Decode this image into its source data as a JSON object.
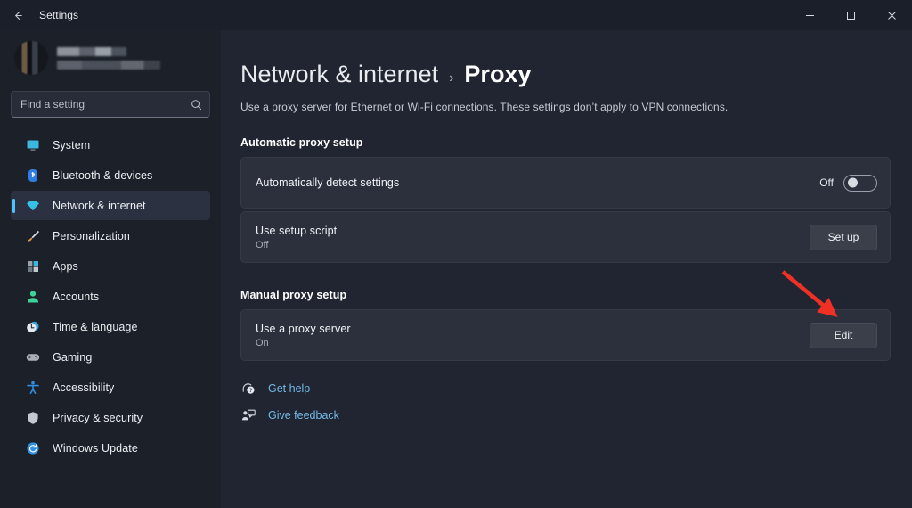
{
  "window": {
    "titlebar_title": "Settings",
    "back_icon": "arrow-left-icon",
    "minimize_label": "Minimize",
    "maximize_label": "Maximize",
    "close_label": "Close"
  },
  "sidebar": {
    "profile": {
      "redacted": true,
      "avatar_icon": "user-avatar"
    },
    "search": {
      "placeholder": "Find a setting",
      "value": "",
      "icon": "search-icon"
    },
    "items": [
      {
        "label": "System",
        "icon": "monitor-icon",
        "active": false
      },
      {
        "label": "Bluetooth & devices",
        "icon": "bluetooth-icon",
        "active": false
      },
      {
        "label": "Network & internet",
        "icon": "wifi-icon",
        "active": true
      },
      {
        "label": "Personalization",
        "icon": "paintbrush-icon",
        "active": false
      },
      {
        "label": "Apps",
        "icon": "apps-grid-icon",
        "active": false
      },
      {
        "label": "Accounts",
        "icon": "person-icon",
        "active": false
      },
      {
        "label": "Time & language",
        "icon": "clock-icon",
        "active": false
      },
      {
        "label": "Gaming",
        "icon": "gamepad-icon",
        "active": false
      },
      {
        "label": "Accessibility",
        "icon": "accessibility-icon",
        "active": false
      },
      {
        "label": "Privacy & security",
        "icon": "shield-icon",
        "active": false
      },
      {
        "label": "Windows Update",
        "icon": "refresh-icon",
        "active": false
      }
    ]
  },
  "main": {
    "breadcrumb": {
      "root": "Network & internet",
      "separator": "›",
      "leaf": "Proxy"
    },
    "description": "Use a proxy server for Ethernet or Wi-Fi connections. These settings don’t apply to VPN connections.",
    "sections": [
      {
        "title": "Automatic proxy setup",
        "cards": [
          {
            "title": "Automatically detect settings",
            "subtitle": "",
            "control": "toggle",
            "toggle_label": "Off",
            "toggle_state": "off"
          },
          {
            "title": "Use setup script",
            "subtitle": "Off",
            "control": "button",
            "button_label": "Set up"
          }
        ]
      },
      {
        "title": "Manual proxy setup",
        "cards": [
          {
            "title": "Use a proxy server",
            "subtitle": "On",
            "control": "button",
            "button_label": "Edit"
          }
        ]
      }
    ],
    "footer_links": [
      {
        "label": "Get help",
        "icon": "help-question-icon"
      },
      {
        "label": "Give feedback",
        "icon": "feedback-person-icon"
      }
    ]
  },
  "annotation": {
    "type": "arrow",
    "color": "#ee3124",
    "points_to": "Edit"
  },
  "colors": {
    "page_bg": "#202531",
    "sidebar_bg": "#1b2029",
    "titlebar_bg": "#1b1f29",
    "card_bg": "#2b303c",
    "accent": "#4cc2ff",
    "link": "#74b9e7",
    "button_bg": "#3a3f4a",
    "annotation_red": "#ee3124"
  }
}
